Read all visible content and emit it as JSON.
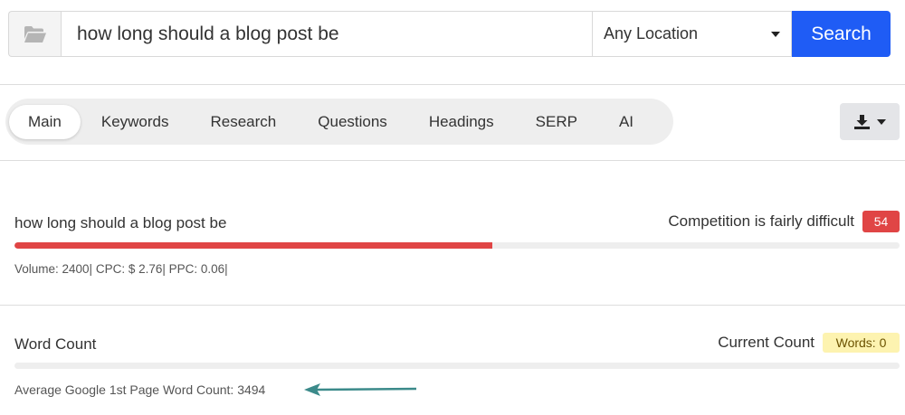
{
  "search": {
    "query": "how long should a blog post be",
    "location": "Any Location",
    "button_label": "Search"
  },
  "tabs": [
    {
      "label": "Main",
      "active": true
    },
    {
      "label": "Keywords",
      "active": false
    },
    {
      "label": "Research",
      "active": false
    },
    {
      "label": "Questions",
      "active": false
    },
    {
      "label": "Headings",
      "active": false
    },
    {
      "label": "SERP",
      "active": false
    },
    {
      "label": "AI",
      "active": false
    }
  ],
  "icons": {
    "folder": "folder-open-icon",
    "download": "download-icon",
    "dropdown": "caret-down-icon",
    "annotation": "arrow-left-icon"
  },
  "keyword": {
    "title": "how long should a blog post be",
    "competition_label": "Competition is fairly difficult",
    "competition_score": "54",
    "difficulty_percent": 54,
    "metrics": "Volume: 2400| CPC: $ 2.76| PPC: 0.06|"
  },
  "word_count": {
    "title": "Word Count",
    "current_label": "Current Count",
    "current_badge": "Words: 0",
    "progress_percent": 0,
    "average_text": "Average Google 1st Page Word Count: 3494"
  },
  "colors": {
    "primary": "#1f5cf5",
    "danger": "#e04545",
    "warning_bg": "#fdf3b0",
    "annotation_arrow": "#3b8a8a"
  }
}
